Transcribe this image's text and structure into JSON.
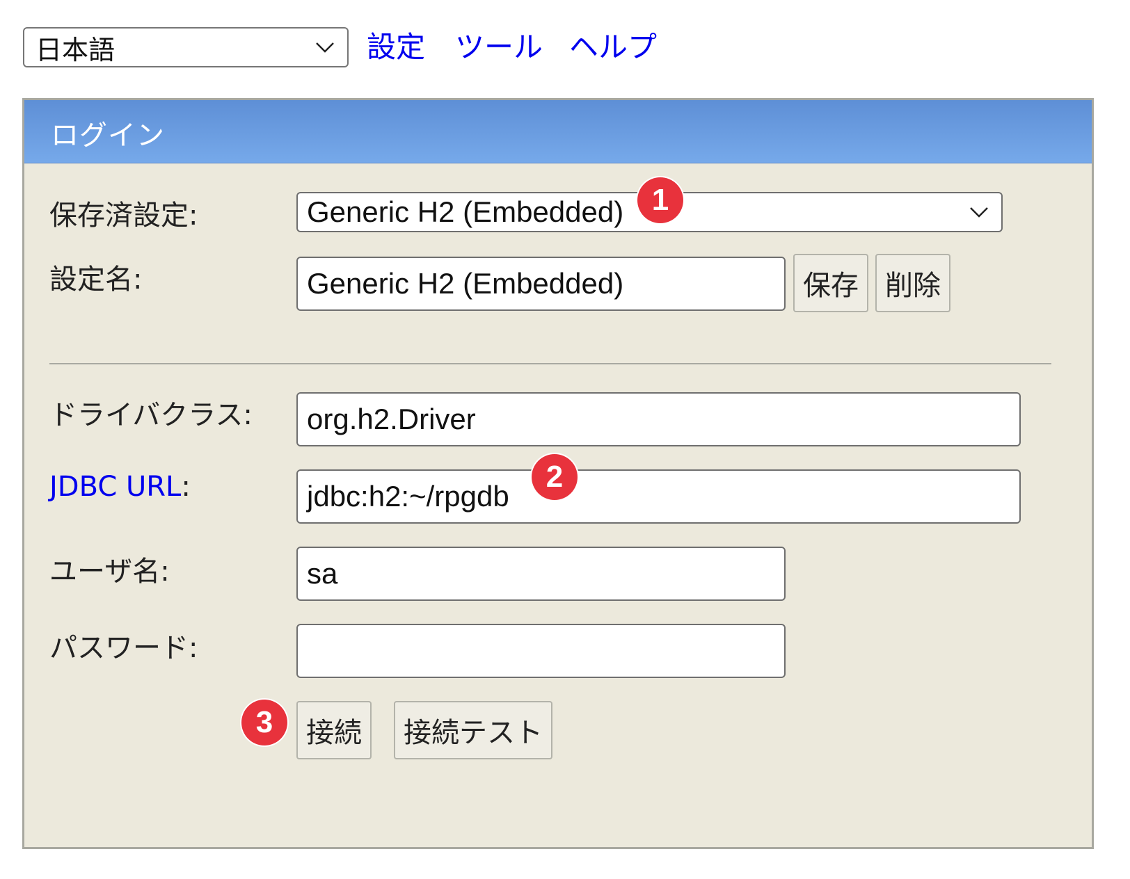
{
  "header": {
    "language_selected": "日本語",
    "links": {
      "settings": "設定",
      "tools": "ツール",
      "help": "ヘルプ"
    }
  },
  "login_panel": {
    "title": "ログイン",
    "saved_settings_label": "保存済設定:",
    "saved_settings_value": "Generic H2 (Embedded)",
    "setting_name_label": "設定名:",
    "setting_name_value": "Generic H2 (Embedded)",
    "save_label": "保存",
    "delete_label": "削除",
    "driver_class_label": "ドライバクラス:",
    "driver_class_value": "org.h2.Driver",
    "jdbc_url_link": "JDBC URL",
    "jdbc_url_colon": ":",
    "jdbc_url_value": "jdbc:h2:~/rpgdb",
    "username_label": "ユーザ名:",
    "username_value": "sa",
    "password_label": "パスワード:",
    "password_value": "",
    "connect_label": "接続",
    "test_connection_label": "接続テスト"
  },
  "markers": [
    "1",
    "2",
    "3"
  ],
  "colors": {
    "header_gradient_top": "#5e8fd6",
    "header_gradient_bottom": "#76a9ea",
    "panel_background": "#ece9dc",
    "link_color": "#0000ee",
    "marker_red": "#e8323c"
  },
  "icons": {
    "dropdown": "chevron-down-icon"
  }
}
